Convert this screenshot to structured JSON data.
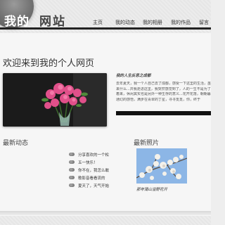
{
  "header": {
    "logo_word1": "我的",
    "logo_word2": "网站",
    "nav": [
      "主页",
      "我的动态",
      "我的相册",
      "我的作品",
      "留言"
    ]
  },
  "hero": {
    "title": "欢迎来到我的个人网页",
    "subtitle": "我的人生反思之成都",
    "text_lines": [
      "去年夏天，我一个人自己去了成都，感受一下这里的生活，虽然说来",
      "来什么...并我走进这里，我突然感觉到了，人的一生不是为了活",
      "着来，休闲其实也是另外一种生存的意义...花开花落，朝朝暮暮，",
      "通幻的感悟，满步在青翠的丁星，寻寻觅觅，你，终于"
    ]
  },
  "news": {
    "title": "最新动态",
    "items": [
      "分享喜欢的一个松",
      "五一快乐！",
      "你不在，我怎么敢",
      "歌影音看看流的",
      "夏天了，天气开始"
    ]
  },
  "photos": {
    "title": "最新照片",
    "caption": "那年蒲山溢野花开"
  }
}
